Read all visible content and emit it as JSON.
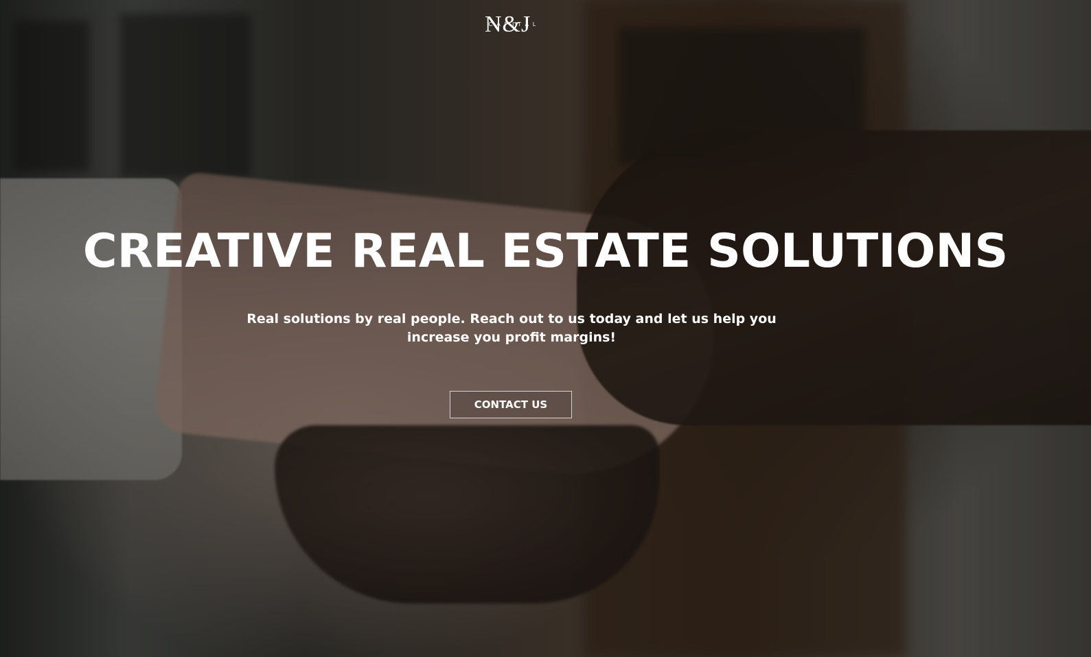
{
  "logo": {
    "main_text": "N&J",
    "sub_text": "CAPITAL"
  },
  "hero": {
    "headline": "CREATIVE REAL ESTATE SOLUTIONS",
    "subtext": "Real solutions by real people. Reach out to us today and let us help you increase you profit margins!",
    "cta_label": "CONTACT US",
    "background_image": "handshake-photo"
  },
  "colors": {
    "text": "#ffffff",
    "overlay": "#000000"
  }
}
